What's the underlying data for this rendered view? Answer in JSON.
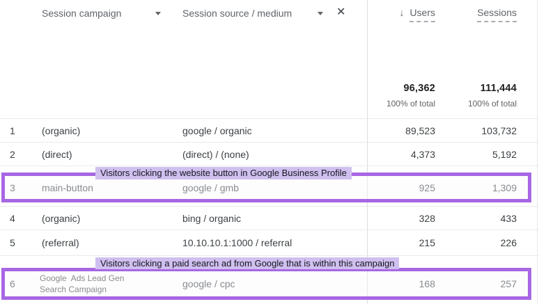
{
  "header": {
    "campaign_label": "Session campaign",
    "source_medium_label": "Session source / medium",
    "users_label": "Users",
    "sessions_label": "Sessions",
    "sort_icon": "↓",
    "close_icon": "✕"
  },
  "totals": {
    "users_value": "96,362",
    "users_sub": "100% of total",
    "sessions_value": "111,444",
    "sessions_sub": "100% of total"
  },
  "rows": [
    {
      "index": "1",
      "campaign": "(organic)",
      "source_medium": "google / organic",
      "users": "89,523",
      "sessions": "103,732"
    },
    {
      "index": "2",
      "campaign": "(direct)",
      "source_medium": "(direct) / (none)",
      "users": "4,373",
      "sessions": "5,192"
    },
    {
      "index": "3",
      "campaign": "main-button",
      "source_medium": "google / gmb",
      "users": "925",
      "sessions": "1,309",
      "annotation": "Visitors clicking the website button in Google Business Profile"
    },
    {
      "index": "4",
      "campaign": "(organic)",
      "source_medium": "bing / organic",
      "users": "328",
      "sessions": "433"
    },
    {
      "index": "5",
      "campaign": "(referral)",
      "source_medium": "10.10.10.1:1000 / referral",
      "users": "215",
      "sessions": "226"
    },
    {
      "index": "6",
      "campaign": "Google  Ads Lead Gen\nSearch Campaign",
      "source_medium": "google / cpc",
      "users": "168",
      "sessions": "257",
      "annotation": "Visitors clicking a paid search ad from Google that is within this campaign"
    }
  ],
  "colors": {
    "highlight_border": "#a767e3",
    "annotation_bg": "#cfc0ef",
    "divider": "#dadce0",
    "text_primary": "#3c4043",
    "text_secondary": "#5f6368"
  }
}
